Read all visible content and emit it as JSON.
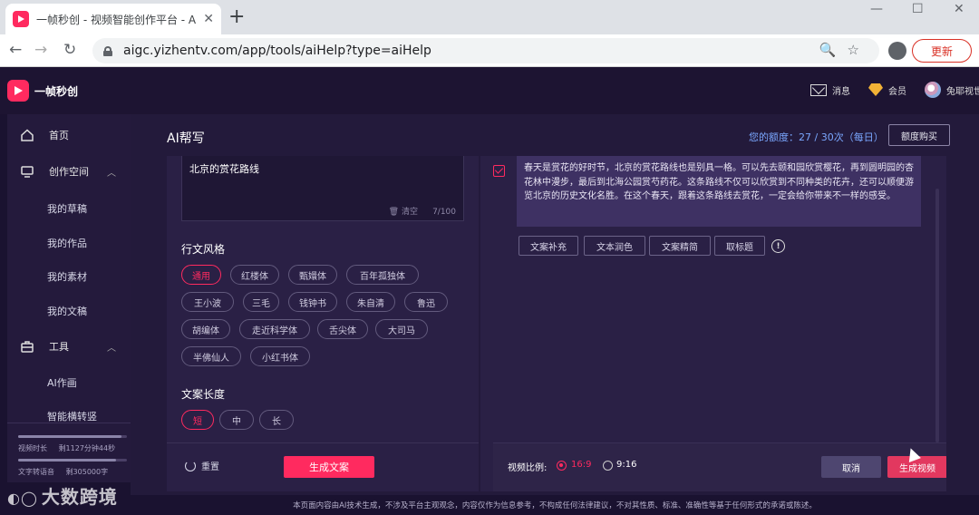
{
  "browser": {
    "tab_title": "一帧秒创 - 视频智能创作平台 - A",
    "url": "aigc.yizhentv.com/app/tools/aiHelp?type=aiHelp",
    "update_label": "更新"
  },
  "header": {
    "brand": "一帧秒创",
    "messages": "消息",
    "member": "会员",
    "user": "兔耶视世"
  },
  "sidebar": {
    "items": [
      {
        "label": "首页"
      },
      {
        "label": "创作空间"
      },
      {
        "label": "我的草稿"
      },
      {
        "label": "我的作品"
      },
      {
        "label": "我的素材"
      },
      {
        "label": "我的文稿"
      },
      {
        "label": "工具"
      },
      {
        "label": "AI作画"
      },
      {
        "label": "智能横转竖"
      }
    ],
    "usage": {
      "video_label": "视频时长",
      "video_remaining": "剩1127分钟44秒",
      "video_fraction": 0.95,
      "tts_label": "文字转语音",
      "tts_remaining": "剩305000字",
      "tts_fraction": 0.9
    }
  },
  "main": {
    "title": "AI帮写",
    "quota": "您的额度：27 / 30次（每日）",
    "buy_label": "额度购买",
    "topic": {
      "value": "北京的赏花路线",
      "clear_label": "清空",
      "count": "7/100"
    },
    "style_label": "行文风格",
    "styles": [
      "通用",
      "红楼体",
      "甄嬛体",
      "百年孤独体",
      "王小波",
      "三毛",
      "钱钟书",
      "朱自清",
      "鲁迅",
      "胡编体",
      "走近科学体",
      "舌尖体",
      "大司马",
      "半佛仙人",
      "小红书体"
    ],
    "length_label": "文案长度",
    "lengths": [
      "短",
      "中",
      "长"
    ],
    "reset_label": "重置",
    "generate_label": "生成文案",
    "result_text": "春天是赏花的好时节，北京的赏花路线也是别具一格。可以先去颐和园欣赏樱花，再到圆明园的杏花林中漫步，最后到北海公园赏芍药花。这条路线不仅可以欣赏到不同种类的花卉，还可以顺便游览北京的历史文化名胜。在这个春天，跟着这条路线去赏花，一定会给你带来不一样的感受。",
    "actions": [
      "文案补充",
      "文本润色",
      "文案精简",
      "取标题"
    ],
    "ratio_label": "视频比例:",
    "ratio_options": [
      "16:9",
      "9:16"
    ],
    "cancel_label": "取消",
    "generate_video_label": "生成视频"
  },
  "footer": {
    "disclaimer": "本页面内容由AI技术生成，不涉及平台主观观念，内容仅作为信息参考，不构成任何法律建议，不对其性质、标准、准确性等基于任何形式的承诺或陈述。"
  },
  "watermark": "大数跨境",
  "colors": {
    "accent": "#ff2a5f",
    "bg": "#231a3b",
    "link": "#7aa7ff"
  }
}
